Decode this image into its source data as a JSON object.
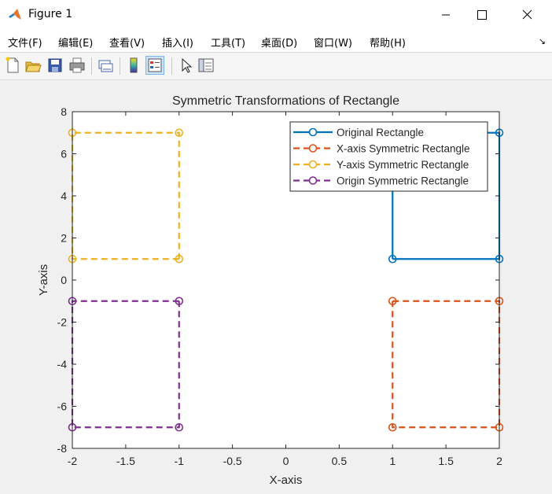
{
  "window": {
    "title": "Figure 1",
    "buttons": [
      "minimize",
      "maximize",
      "close"
    ]
  },
  "menubar": {
    "items": [
      "文件(F)",
      "编辑(E)",
      "查看(V)",
      "插入(I)",
      "工具(T)",
      "桌面(D)",
      "窗口(W)",
      "帮助(H)"
    ]
  },
  "toolbar": {
    "icons": [
      "new-figure-icon",
      "open-file-icon",
      "save-icon",
      "print-icon",
      "link-plot-icon",
      "insert-colorbar-icon",
      "insert-legend-icon",
      "pointer-icon",
      "property-inspector-icon"
    ]
  },
  "colors": {
    "original": "#0072BD",
    "x_sym": "#D95319",
    "y_sym": "#EDB120",
    "origin_sym": "#7E2F8E"
  },
  "chart_data": {
    "type": "line",
    "title": "Symmetric Transformations of Rectangle",
    "xlabel": "X-axis",
    "ylabel": "Y-axis",
    "xlim": [
      -2,
      2
    ],
    "ylim": [
      -8,
      8
    ],
    "xticks": [
      -2,
      -1.5,
      -1,
      -0.5,
      0,
      0.5,
      1,
      1.5,
      2
    ],
    "yticks": [
      -8,
      -6,
      -4,
      -2,
      0,
      2,
      4,
      6,
      8
    ],
    "xtick_labels": [
      "-2",
      "-1.5",
      "-1",
      "-0.5",
      "0",
      "0.5",
      "1",
      "1.5",
      "2"
    ],
    "ytick_labels": [
      "-8",
      "-6",
      "-4",
      "-2",
      "0",
      "2",
      "4",
      "6",
      "8"
    ],
    "grid": false,
    "legend_position": "top-right",
    "series": [
      {
        "name": "Original Rectangle",
        "style": "solid",
        "color": "#0072BD",
        "x": [
          1,
          2,
          2,
          1,
          1
        ],
        "y": [
          1,
          1,
          7,
          7,
          1
        ]
      },
      {
        "name": "X-axis Symmetric Rectangle",
        "style": "dashed",
        "color": "#D95319",
        "x": [
          1,
          2,
          2,
          1,
          1
        ],
        "y": [
          -1,
          -1,
          -7,
          -7,
          -1
        ]
      },
      {
        "name": "Y-axis Symmetric Rectangle",
        "style": "dashed",
        "color": "#EDB120",
        "x": [
          -1,
          -2,
          -2,
          -1,
          -1
        ],
        "y": [
          1,
          1,
          7,
          7,
          1
        ]
      },
      {
        "name": "Origin Symmetric Rectangle",
        "style": "dashed",
        "color": "#7E2F8E",
        "x": [
          -1,
          -2,
          -2,
          -1,
          -1
        ],
        "y": [
          -1,
          -1,
          -7,
          -7,
          -1
        ]
      }
    ]
  }
}
